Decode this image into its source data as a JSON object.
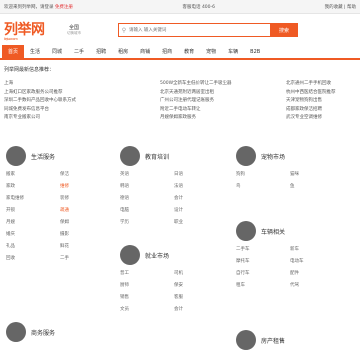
{
  "topbar": {
    "left": "欢迎来到列举网，请登录",
    "left_red": "免费注册",
    "center": "客服电话 400-6",
    "right": "我的收藏 | 帮助"
  },
  "header": {
    "logo": "列举网",
    "logo_sub": "liejuw.com",
    "city": "全国",
    "city_sub": "切换城市",
    "search_placeholder": "请输入 输入关键词",
    "search_button": "搜索"
  },
  "nav": {
    "items": [
      "首页",
      "生活",
      "同城",
      "二手",
      "招聘",
      "租房",
      "商铺",
      "招商",
      "教育",
      "宠物",
      "车辆",
      "B2B"
    ],
    "active_index": 0
  },
  "hotbar": {
    "title": "列举网最新信息推荐：",
    "col1": [
      "上海",
      "上海虹口区家政服务公司推荐",
      "深圳二手数码产品回收中心联系方式",
      "同城免费发布信息平台",
      "南京专业搬家公司"
    ],
    "col2": [
      "500W全新车主低价转让二手吸尘器",
      "北京天通苑附近两居室出租",
      "广州公司注册代理记账服务",
      "附近二手电动车转让",
      "月嫂保姆家政服务"
    ],
    "col3": [
      "北京通州二手手机回收",
      "杭州中西医结合医院推荐",
      "天津宠物狗狗出售",
      "成都家政保洁招聘",
      "武汉专业空调维修"
    ]
  },
  "panels": [
    {
      "title": "生活服务",
      "items": [
        "搬家",
        "保洁",
        "家政",
        "维修",
        "家电维修",
        "装修",
        "开锁",
        "疏通",
        "月嫂",
        "保姆",
        "婚庆",
        "摄影",
        "礼品",
        "鲜花",
        "回收",
        "二手",
        "宠物",
        "旅游"
      ]
    },
    {
      "title": "教育培训",
      "items": [
        "英语",
        "日语",
        "韩语",
        "法语",
        "德语",
        "会计",
        "电脑",
        "设计",
        "学历",
        "职业",
        "家教",
        "驾校",
        "艺术",
        "音乐",
        "舞蹈",
        "美术"
      ]
    },
    {
      "title": "宠物市场",
      "items": [
        "狗狗",
        "猫咪",
        "鸟",
        "鱼",
        "兔子",
        "仓鼠",
        "宠物用品",
        "宠物医院",
        "宠物服务",
        "宠物寄养"
      ]
    },
    {
      "title": "就业市场",
      "items": [
        "普工",
        "司机",
        "厨师",
        "保安",
        "销售",
        "客服",
        "文员",
        "会计",
        "服务员",
        "技工",
        "设计",
        "IT"
      ]
    },
    {
      "title": "车辆相关",
      "items": [
        "二手车",
        "新车",
        "摩托车",
        "电动车",
        "自行车",
        "配件",
        "租车",
        "代驾",
        "陪驾",
        "年检"
      ]
    }
  ],
  "bottom": {
    "left_title": "商务服务",
    "right_title": "房产租售"
  }
}
